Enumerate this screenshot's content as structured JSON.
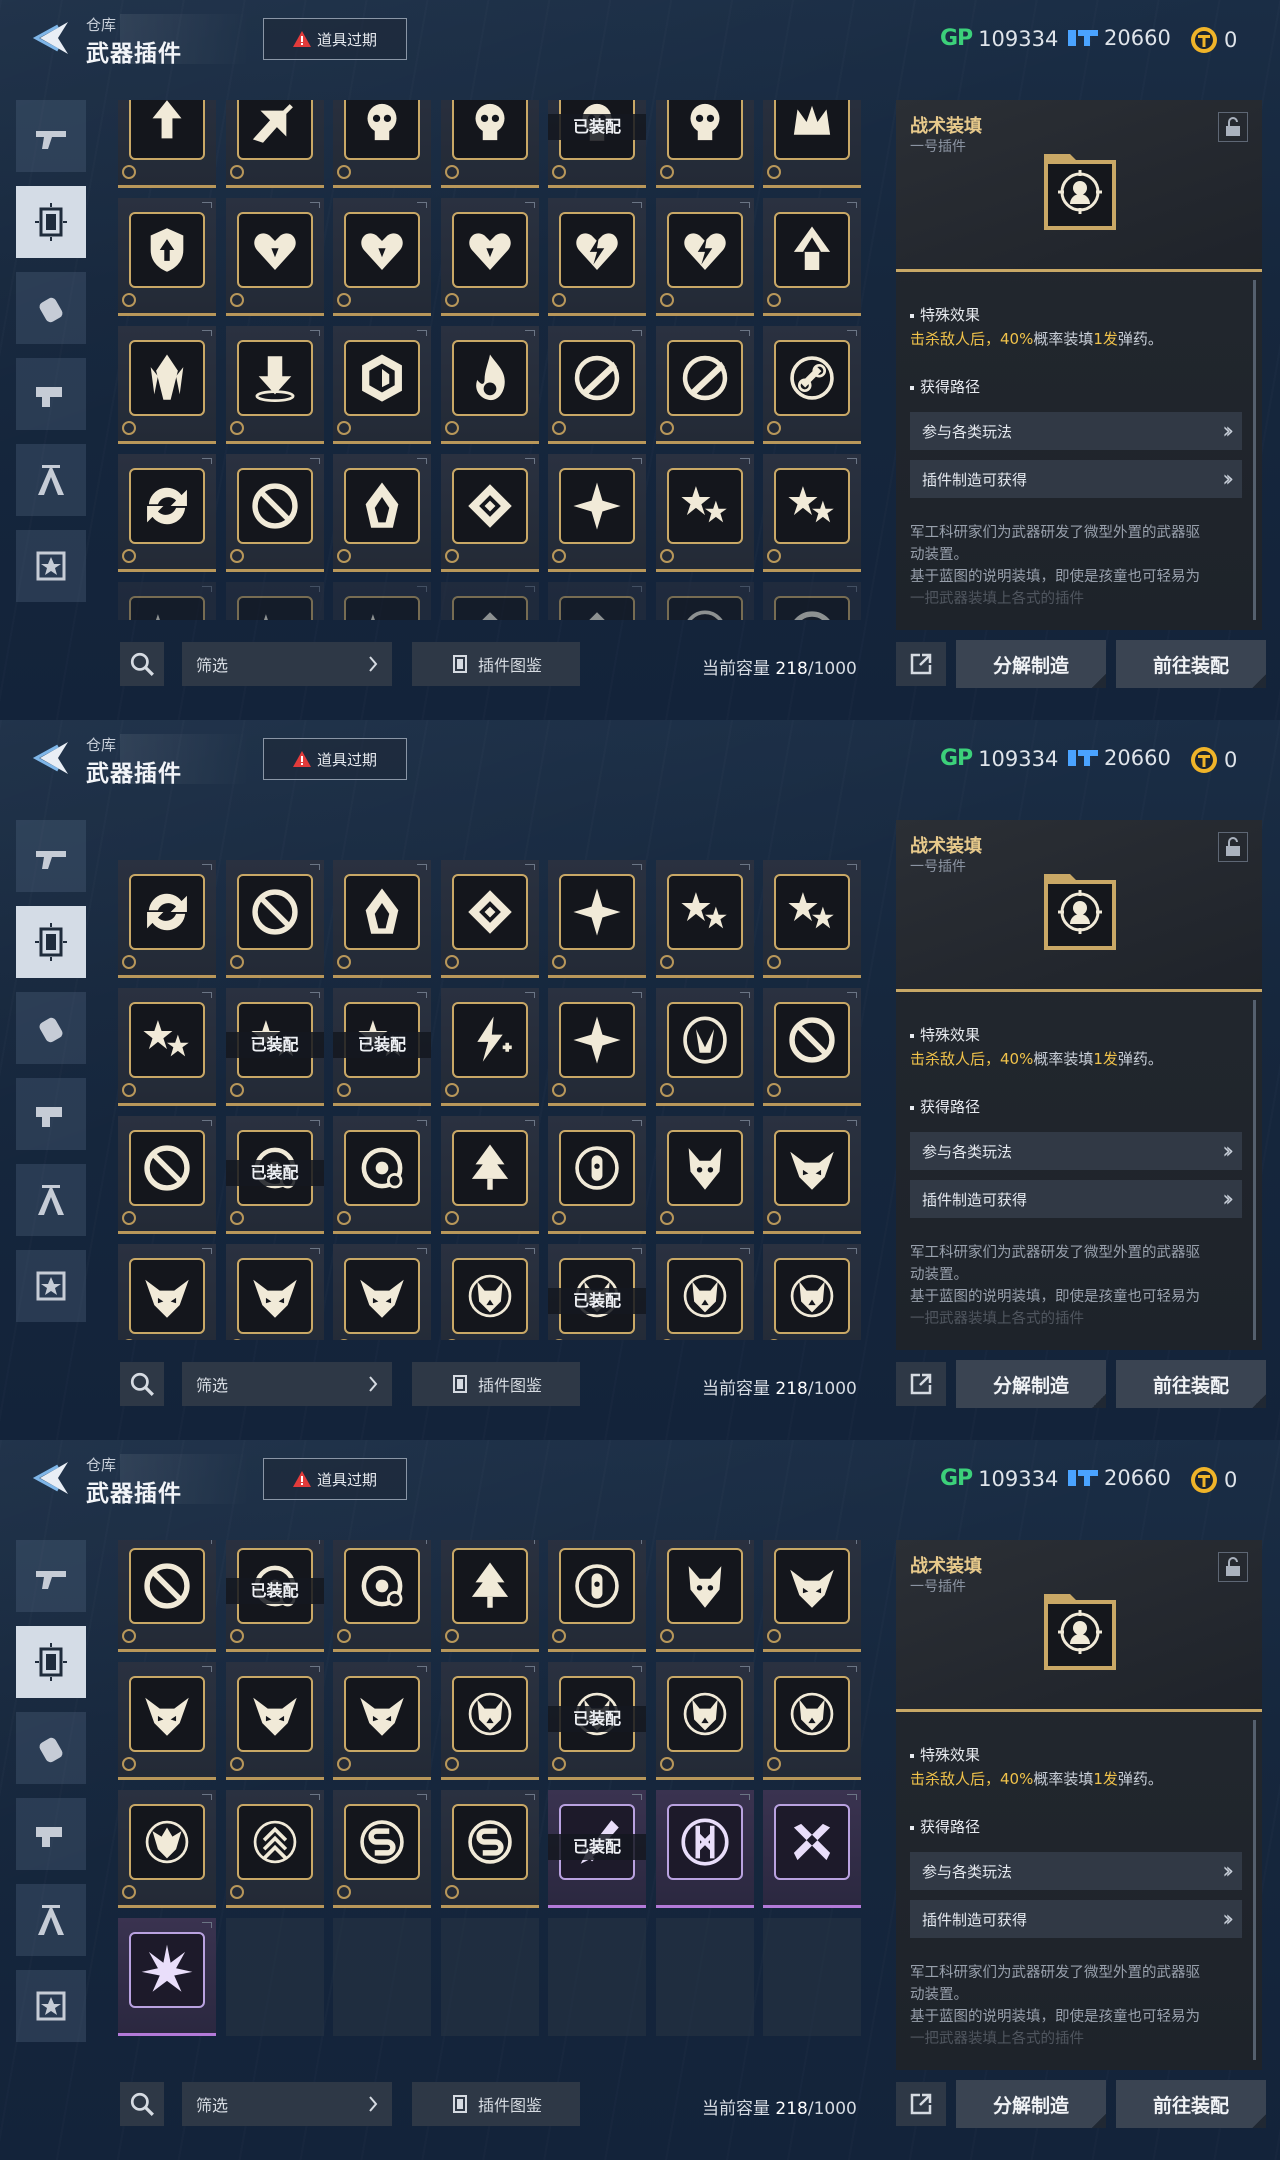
{
  "header": {
    "crumb": "仓库",
    "title": "武器插件",
    "expire_label": "道具过期",
    "currencies": [
      {
        "icon": "gp-icon",
        "label": "GP",
        "value": "109334"
      },
      {
        "icon": "ticket-icon",
        "value": "20660"
      },
      {
        "icon": "coin-icon",
        "value": "0"
      }
    ]
  },
  "sidebar": {
    "tabs": [
      {
        "icon": "gun-icon",
        "active": false
      },
      {
        "icon": "plugin-icon",
        "active": true
      },
      {
        "icon": "grenade-icon",
        "active": false
      },
      {
        "icon": "tool-icon",
        "active": false
      },
      {
        "icon": "character-icon",
        "active": false
      },
      {
        "icon": "badge-icon",
        "active": false
      }
    ]
  },
  "grid": {
    "equipped_label": "已装配"
  },
  "panels": [
    {
      "rows": [
        [
          "upgrade",
          "split-arrows",
          "skull",
          "skull",
          "skull",
          "skull",
          "crown"
        ],
        [
          "shield-arrow",
          "heart-shield",
          "heart-shield",
          "heart-shield",
          "heart-bolt",
          "heart-bolt",
          "arrow-up"
        ],
        [
          "crystal",
          "drop-down",
          "hex-shield",
          "flame",
          "slash",
          "slash",
          "link"
        ],
        [
          "cycle",
          "no-entry",
          "hood",
          "diamond",
          "burst",
          "stars",
          "stars"
        ],
        [
          "stars",
          "stars",
          "stars",
          "diamond",
          "diamond",
          "crest",
          "no-entry"
        ]
      ],
      "equipped": [
        [
          0,
          4
        ],
        [
          4,
          1
        ],
        [
          4,
          2
        ]
      ]
    },
    {
      "rows": [
        [
          "none",
          "none",
          "none",
          "none",
          "none",
          "none",
          "none"
        ],
        [
          "cycle",
          "no-entry",
          "hood",
          "diamond",
          "burst",
          "stars",
          "stars"
        ],
        [
          "stars",
          "stars",
          "stars",
          "bolt-plus",
          "burst",
          "crest",
          "no-entry"
        ],
        [
          "no-entry",
          "gear-target",
          "gear-target",
          "tree",
          "lock-target",
          "wolf",
          "demon"
        ],
        [
          "demon",
          "demon",
          "demon",
          "husky",
          "husky",
          "husky",
          "husky"
        ]
      ],
      "equipped": [
        [
          2,
          1
        ],
        [
          2,
          2
        ],
        [
          3,
          1
        ],
        [
          4,
          4
        ]
      ]
    },
    {
      "rows": [
        [
          "no-entry",
          "gear-target",
          "gear-target",
          "tree",
          "lock-target",
          "wolf",
          "demon"
        ],
        [
          "demon",
          "demon",
          "demon",
          "husky",
          "husky",
          "husky",
          "husky"
        ],
        [
          "dragon",
          "chevrons",
          "s-mark",
          "s-mark",
          "p-blade",
          "p-emblem",
          "p-cross"
        ],
        [
          "p-burst",
          "empty",
          "empty",
          "empty",
          "empty",
          "empty",
          "empty"
        ]
      ],
      "equipped": [
        [
          0,
          1
        ],
        [
          1,
          4
        ],
        [
          2,
          4
        ]
      ]
    }
  ],
  "detail": {
    "name": "战术装填",
    "sub": "一号插件",
    "effect_title": "特殊效果",
    "effect_pre": "击杀敌人后，",
    "effect_pct": "40%",
    "effect_mid": "概率装填",
    "effect_num": "1发",
    "effect_post": "弹药。",
    "path_title": "获得路径",
    "path_buttons": [
      "参与各类玩法",
      "插件制造可获得"
    ],
    "desc_1": "军工科研家们为武器研发了微型外置的武器驱",
    "desc_2": "动装置。",
    "desc_3": "基于蓝图的说明装填，即使是孩童也可轻易为",
    "desc_4": "一把武器装填上各式的插件"
  },
  "footer": {
    "filter_label": "筛选",
    "codex_label": "插件图鉴",
    "capacity_label": "当前容量",
    "capacity_used": "218",
    "capacity_max": "/1000",
    "dismantle_label": "分解制造",
    "equip_label": "前往装配"
  }
}
